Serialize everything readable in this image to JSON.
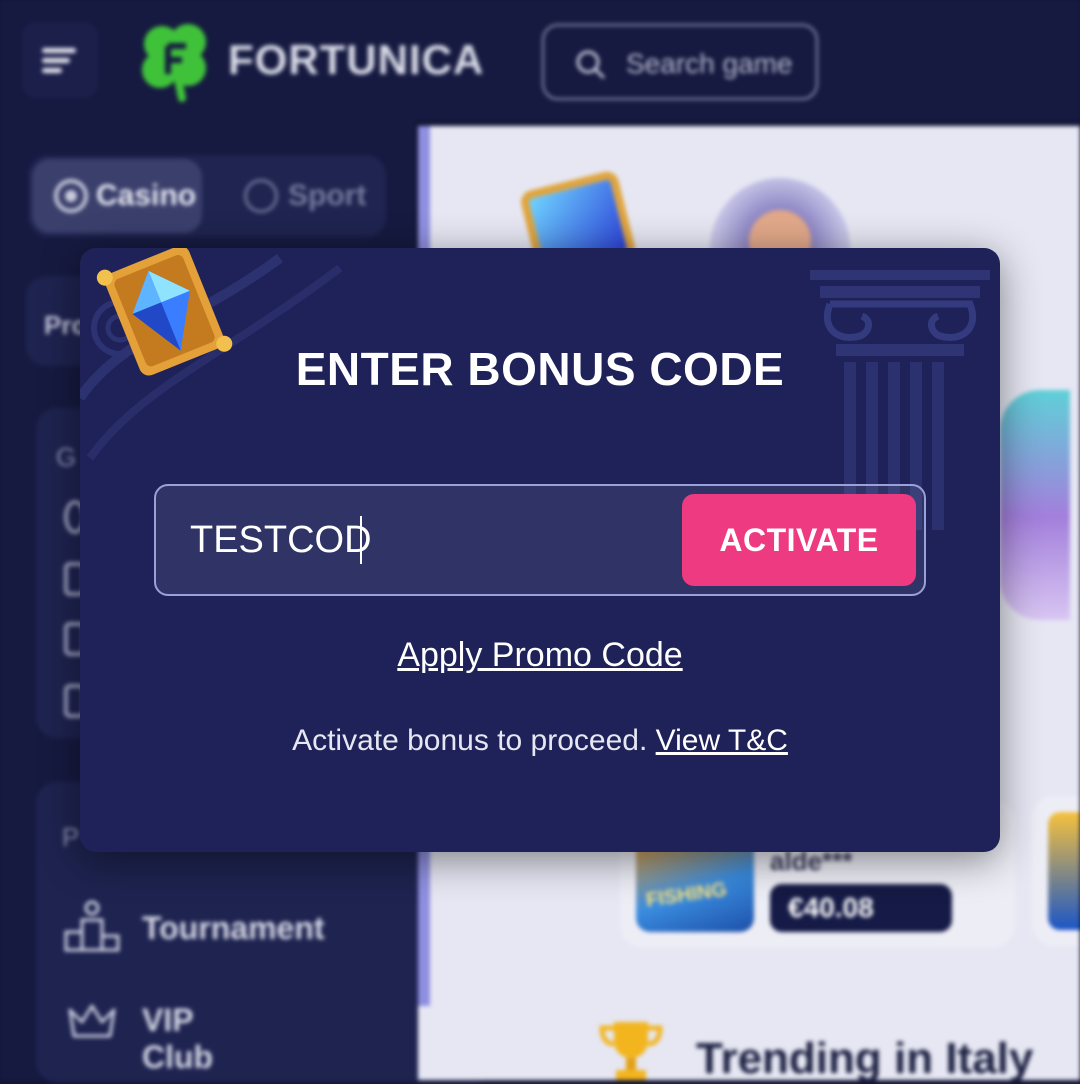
{
  "header": {
    "logo_text": "FORTUNICA",
    "search_placeholder": "Search game"
  },
  "sidebar": {
    "tabs": [
      {
        "label": "Casino",
        "active": true
      },
      {
        "label": "Sport",
        "active": false
      }
    ],
    "card_fragments": [
      "Pro",
      "G",
      "P"
    ],
    "items": [
      {
        "label": "Tournament",
        "icon": "podium-icon"
      },
      {
        "label": "VIP Club",
        "icon": "crown-icon"
      }
    ]
  },
  "main": {
    "winner": {
      "name": "alde***",
      "amount": "€40.08",
      "game": "FISHING"
    },
    "section_title": "Trending in Italy"
  },
  "modal": {
    "title": "ENTER BONUS CODE",
    "code_value": "TESTCOD",
    "activate_label": "ACTIVATE",
    "promo_link": "Apply Promo Code",
    "footer_text": "Activate bonus to proceed.",
    "terms_link": "View T&C"
  },
  "colors": {
    "modal_bg": "#1e2258",
    "accent": "#ee3a80",
    "brand_green": "#3fc23a",
    "page_bg": "#141638"
  }
}
